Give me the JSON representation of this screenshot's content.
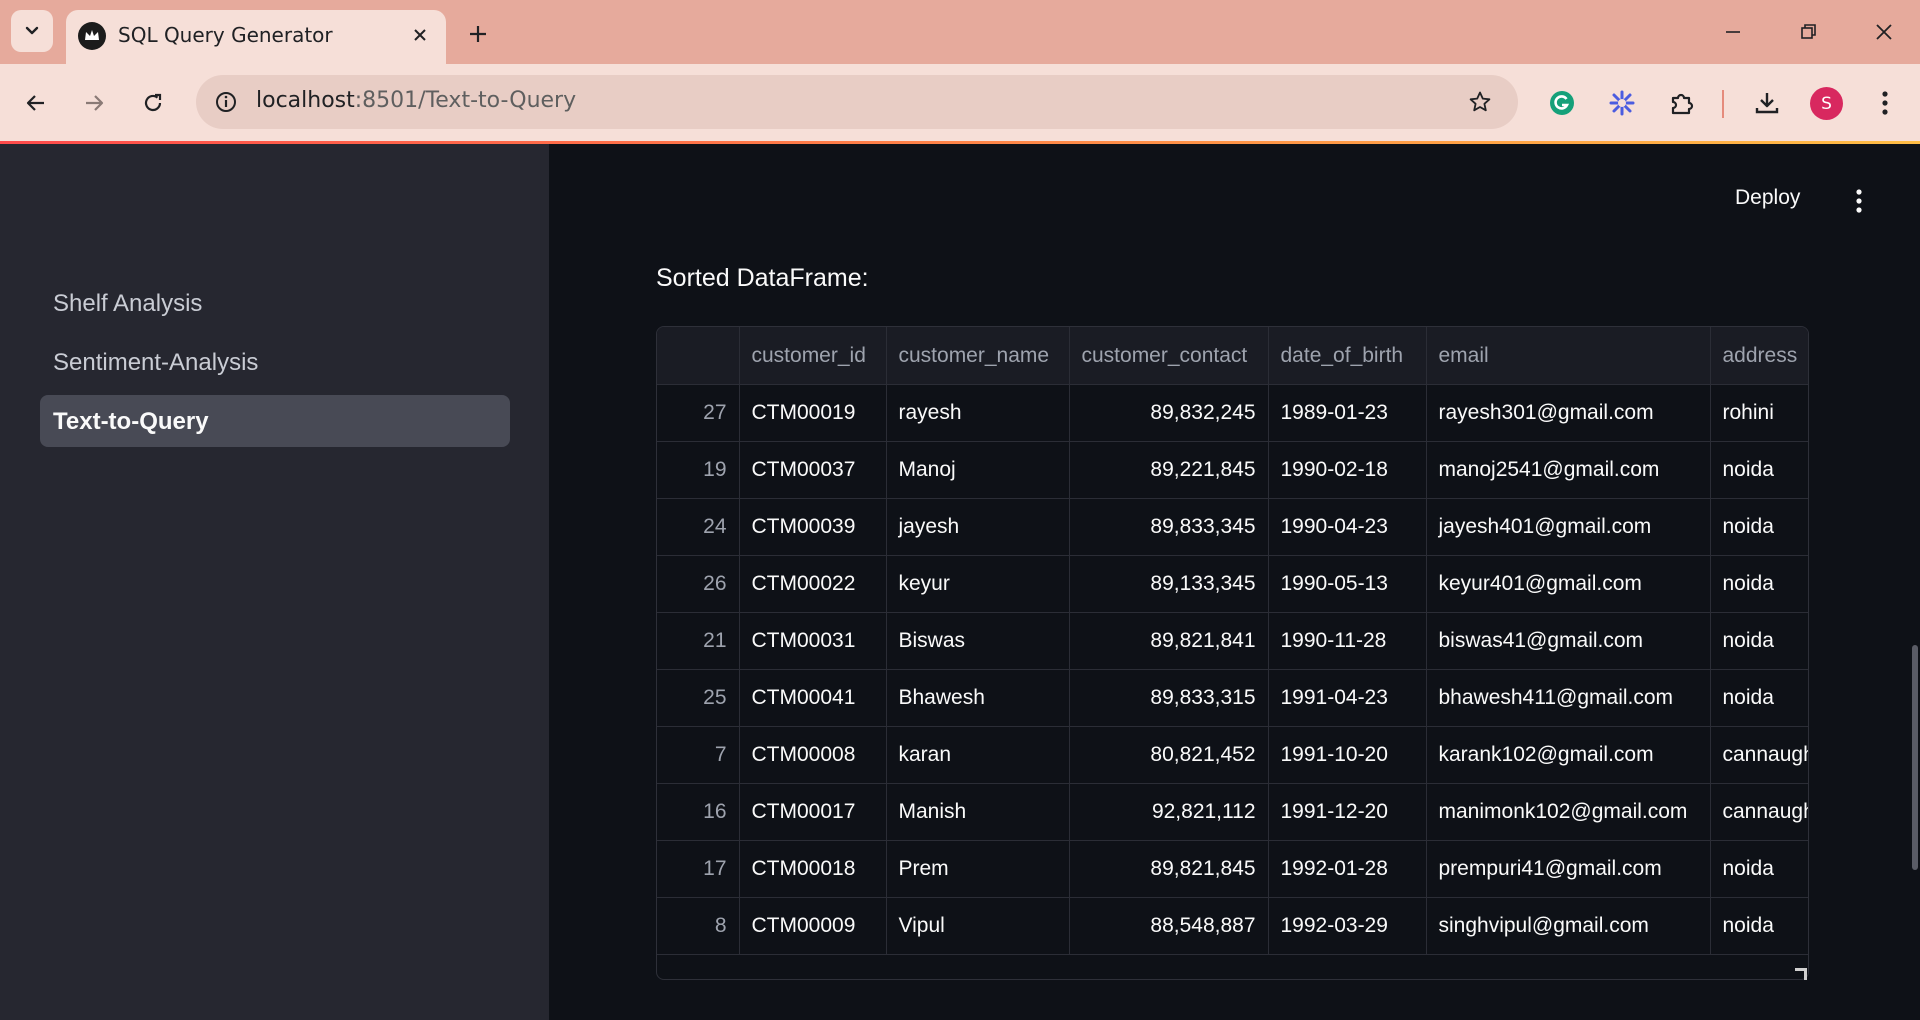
{
  "browser": {
    "tab_title": "SQL Query Generator",
    "url_host": "localhost",
    "url_rest": ":8501/Text-to-Query",
    "avatar_letter": "S"
  },
  "icons": {
    "tab_dropdown": "chevron-down-icon",
    "favicon": "streamlit-crown-icon",
    "close": "close-icon",
    "new_tab": "plus-icon",
    "back": "arrow-left-icon",
    "forward": "arrow-right-icon",
    "reload": "reload-icon",
    "site_info": "info-icon",
    "bookmark": "star-icon",
    "extensions": [
      "grammarly-icon",
      "perplexity-icon",
      "puzzle-icon"
    ],
    "downloads": "download-icon",
    "menu": "kebab-menu-icon"
  },
  "sidebar": {
    "items": [
      {
        "label": "Shelf Analysis"
      },
      {
        "label": "Sentiment-Analysis"
      },
      {
        "label": "Text-to-Query",
        "active": true
      }
    ]
  },
  "header": {
    "deploy_label": "Deploy"
  },
  "main": {
    "title": "Sorted DataFrame:",
    "table": {
      "columns": [
        "",
        "customer_id",
        "customer_name",
        "customer_contact",
        "date_of_birth",
        "email",
        "address"
      ],
      "rows": [
        [
          "27",
          "CTM00019",
          "rayesh",
          "89,832,245",
          "1989-01-23",
          "rayesh301@gmail.com",
          "rohini"
        ],
        [
          "19",
          "CTM00037",
          "Manoj",
          "89,221,845",
          "1990-02-18",
          "manoj2541@gmail.com",
          "noida"
        ],
        [
          "24",
          "CTM00039",
          "jayesh",
          "89,833,345",
          "1990-04-23",
          "jayesh401@gmail.com",
          "noida"
        ],
        [
          "26",
          "CTM00022",
          "keyur",
          "89,133,345",
          "1990-05-13",
          "keyur401@gmail.com",
          "noida"
        ],
        [
          "21",
          "CTM00031",
          "Biswas",
          "89,821,841",
          "1990-11-28",
          "biswas41@gmail.com",
          "noida"
        ],
        [
          "25",
          "CTM00041",
          "Bhawesh",
          "89,833,315",
          "1991-04-23",
          "bhawesh411@gmail.com",
          "noida"
        ],
        [
          "7",
          "CTM00008",
          "karan",
          "80,821,452",
          "1991-10-20",
          "karank102@gmail.com",
          "cannaugh"
        ],
        [
          "16",
          "CTM00017",
          "Manish",
          "92,821,112",
          "1991-12-20",
          "manimonk102@gmail.com",
          "cannaugh"
        ],
        [
          "17",
          "CTM00018",
          "Prem",
          "89,821,845",
          "1992-01-28",
          "prempuri41@gmail.com",
          "noida"
        ],
        [
          "8",
          "CTM00009",
          "Vipul",
          "88,548,887",
          "1992-03-29",
          "singhvipul@gmail.com",
          "noida"
        ]
      ]
    }
  },
  "colors": {
    "tabbar": "#e6aa9c",
    "toolbar": "#f6dfd8",
    "sidebar": "#262730",
    "main_bg": "#0e1117",
    "accent": "#ff4b4b"
  }
}
